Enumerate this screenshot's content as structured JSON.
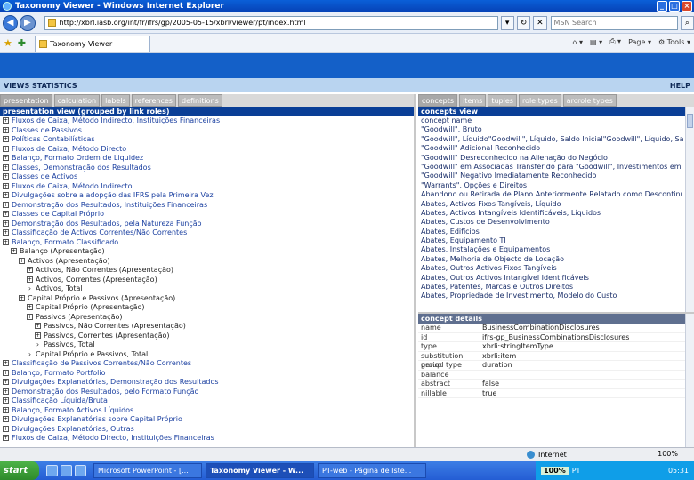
{
  "window": {
    "title": "Taxonomy Viewer - Windows Internet Explorer"
  },
  "address": {
    "url": "http://xbrl.iasb.org/int/fr/ifrs/gp/2005-05-15/xbrl/viewer/pt/index.html",
    "search_placeholder": "MSN Search"
  },
  "tab": {
    "title": "Taxonomy Viewer"
  },
  "toolbar": {
    "page_label": "Page",
    "tools_label": "Tools"
  },
  "app": {
    "views_label": "VIEWS  STATISTICS",
    "help_label": "HELP"
  },
  "left_tabs": [
    "presentation",
    "calculation",
    "labels",
    "references",
    "definitions"
  ],
  "left_header": "presentation view (grouped by link roles)",
  "tree": [
    {
      "text": "Fluxos de Caixa, Método Indirecto, Instituições Financeiras",
      "type": "exp",
      "indent": 0
    },
    {
      "text": "Classes de Passivos",
      "type": "exp",
      "indent": 0
    },
    {
      "text": "Políticas Contabilísticas",
      "type": "exp",
      "indent": 0
    },
    {
      "text": "Fluxos de Caixa, Método Directo",
      "type": "exp",
      "indent": 0
    },
    {
      "text": "Balanço, Formato Ordem de Liquidez",
      "type": "exp",
      "indent": 0
    },
    {
      "text": "Classes, Demonstração dos Resultados",
      "type": "exp",
      "indent": 0
    },
    {
      "text": "Classes de Activos",
      "type": "exp",
      "indent": 0
    },
    {
      "text": "Fluxos de Caixa, Método Indirecto",
      "type": "exp",
      "indent": 0
    },
    {
      "text": "Divulgações sobre a adopção das IFRS pela Primeira Vez",
      "type": "exp",
      "indent": 0
    },
    {
      "text": "Demonstração dos Resultados, Instituições Financeiras",
      "type": "exp",
      "indent": 0
    },
    {
      "text": "Classes de Capital Próprio",
      "type": "exp",
      "indent": 0
    },
    {
      "text": "Demonstração dos Resultados, pela Natureza Função",
      "type": "exp",
      "indent": 0
    },
    {
      "text": "Classificação de Activos Correntes/Não Correntes",
      "type": "exp",
      "indent": 0
    },
    {
      "text": "Balanço, Formato Classificado",
      "type": "exp",
      "indent": 0
    },
    {
      "text": "Balanço (Apresentação)",
      "type": "exp",
      "indent": 1,
      "dark": true
    },
    {
      "text": "Activos (Apresentação)",
      "type": "exp",
      "indent": 2,
      "dark": true
    },
    {
      "text": "Activos, Não Correntes (Apresentação)",
      "type": "exp",
      "indent": 3,
      "dark": true
    },
    {
      "text": "Activos, Correntes (Apresentação)",
      "type": "exp",
      "indent": 3,
      "dark": true
    },
    {
      "text": "Activos, Total",
      "type": "bul",
      "indent": 3,
      "dark": true
    },
    {
      "text": "Capital Próprio e Passivos (Apresentação)",
      "type": "exp",
      "indent": 2,
      "dark": true
    },
    {
      "text": "Capital Próprio (Apresentação)",
      "type": "exp",
      "indent": 3,
      "dark": true
    },
    {
      "text": "Passivos (Apresentação)",
      "type": "exp",
      "indent": 3,
      "dark": true
    },
    {
      "text": "Passivos, Não Correntes (Apresentação)",
      "type": "exp",
      "indent": 4,
      "dark": true
    },
    {
      "text": "Passivos, Correntes (Apresentação)",
      "type": "exp",
      "indent": 4,
      "dark": true
    },
    {
      "text": "Passivos, Total",
      "type": "bul",
      "indent": 4,
      "dark": true
    },
    {
      "text": "Capital Próprio e Passivos, Total",
      "type": "bul",
      "indent": 3,
      "dark": true
    },
    {
      "text": "Classificação de Passivos Correntes/Não Correntes",
      "type": "exp",
      "indent": 0
    },
    {
      "text": "Balanço, Formato Portfolio",
      "type": "exp",
      "indent": 0
    },
    {
      "text": "Divulgações Explanatórias, Demonstração dos Resultados",
      "type": "exp",
      "indent": 0
    },
    {
      "text": "Demonstração dos Resultados, pelo Formato Função",
      "type": "exp",
      "indent": 0
    },
    {
      "text": "Classificação Líquida/Bruta",
      "type": "exp",
      "indent": 0
    },
    {
      "text": "Balanço, Formato Activos Líquidos",
      "type": "exp",
      "indent": 0
    },
    {
      "text": "Divulgações Explanatórias sobre Capital Próprio",
      "type": "exp",
      "indent": 0
    },
    {
      "text": "Divulgações Explanatórias, Outras",
      "type": "exp",
      "indent": 0
    },
    {
      "text": "Fluxos de Caixa, Método Directo, Instituições Financeiras",
      "type": "exp",
      "indent": 0
    }
  ],
  "right_tabs": [
    "concepts",
    "items",
    "tuples",
    "role types",
    "arcrole types"
  ],
  "concepts_header": "concepts view",
  "concepts": [
    "concept name",
    "\"Goodwill\", Bruto",
    "\"Goodwill\", Líquido\"Goodwill\", Líquido, Saldo Inicial\"Goodwill\", Líquido, Saldo Final",
    "\"Goodwill\" Adicional Reconhecido",
    "\"Goodwill\" Desreconhecido na Alienação do Negócio",
    "\"Goodwill\" em Associadas Transferido para \"Goodwill\", Investimentos em Associ",
    "\"Goodwill\" Negativo Imediatamente Reconhecido",
    "\"Warrants\", Opções e Direitos",
    "Abandono ou Retirada de Plano Anteriormente Relatado como Descontinuado",
    "Abates, Activos Fixos Tangíveis, Líquido",
    "Abates, Activos Intangíveis Identificáveis, Líquidos",
    "Abates, Custos de Desenvolvimento",
    "Abates, Edifícios",
    "Abates, Equipamento TI",
    "Abates, Instalações e Equipamentos",
    "Abates, Melhoria de Objecto de Locação",
    "Abates, Outros Activos Fixos Tangíveis",
    "Abates, Outros Activos Intangível Identificáveis",
    "Abates, Patentes, Marcas e Outros Direitos",
    "Abates, Propriedade de Investimento, Modelo do Custo"
  ],
  "details_header": "concept details",
  "details": [
    {
      "k": "name",
      "v": "BusinessCombinationDisclosures"
    },
    {
      "k": "id",
      "v": "ifrs-gp_BusinessCombinationsDisclosures"
    },
    {
      "k": "type",
      "v": "xbrli:stringItemType"
    },
    {
      "k": "substitution group",
      "v": "xbrli:item"
    },
    {
      "k": "period type",
      "v": "duration"
    },
    {
      "k": "balance",
      "v": ""
    },
    {
      "k": "abstract",
      "v": "false"
    },
    {
      "k": "nillable",
      "v": "true"
    }
  ],
  "status": {
    "zone": "Internet",
    "zoom": "100%"
  },
  "taskbar": {
    "start": "start",
    "tasks": [
      "Microsoft PowerPoint - [...",
      "Taxonomy Viewer - W...",
      "PT-web - Página de Iste..."
    ],
    "zoom": "100%",
    "clock": "05:31",
    "lang": "PT"
  }
}
